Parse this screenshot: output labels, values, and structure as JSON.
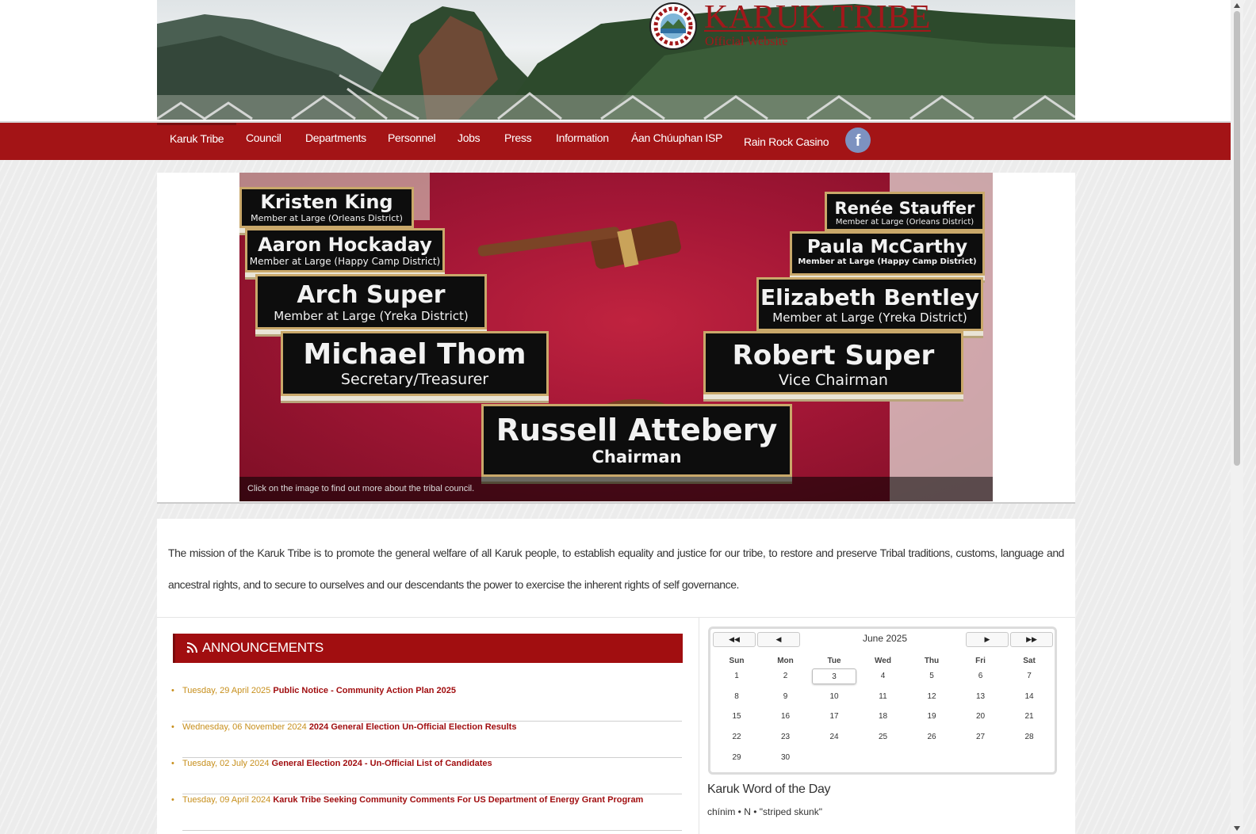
{
  "header": {
    "title": "KARUK TRIBE",
    "subtitle": "Official Website"
  },
  "nav": {
    "items": [
      {
        "label": "Karuk Tribe"
      },
      {
        "label": "Council"
      },
      {
        "label": "Departments"
      },
      {
        "label": "Personnel"
      },
      {
        "label": "Jobs"
      },
      {
        "label": "Press"
      },
      {
        "label": "Information"
      },
      {
        "label": "Áan Chúuphan ISP"
      },
      {
        "label": "Rain Rock Casino"
      }
    ],
    "facebook_icon": "facebook-icon",
    "facebook_glyph": "f"
  },
  "slideshow": {
    "caption": "Click on the image to find out more about the tribal council.",
    "plates": [
      {
        "name": "Kristen King",
        "role": "Member at Large (Orleans District)"
      },
      {
        "name": "Aaron Hockaday",
        "role": "Member at Large (Happy Camp District)"
      },
      {
        "name": "Arch Super",
        "role": "Member at Large (Yreka District)"
      },
      {
        "name": "Michael Thom",
        "role": "Secretary/Treasurer"
      },
      {
        "name": "Renée Stauffer",
        "role": "Member at Large (Orleans District)"
      },
      {
        "name": "Paula McCarthy",
        "role": "Member at Large (Happy Camp District)"
      },
      {
        "name": "Elizabeth Bentley",
        "role": "Member at Large (Yreka District)"
      },
      {
        "name": "Robert Super",
        "role": "Vice Chairman"
      },
      {
        "name": "Russell Attebery",
        "role": "Chairman"
      }
    ]
  },
  "mission": {
    "text": "The mission of the Karuk Tribe is to promote the general welfare of all Karuk people, to establish equality and justice for our tribe, to restore and preserve Tribal traditions, customs, language and ancestral rights, and to secure to ourselves and our descendants the power to exercise the inherent rights of self governance."
  },
  "announcements": {
    "title": "ANNOUNCEMENTS",
    "icon": "rss-icon",
    "items": [
      {
        "date": "Tuesday, 29 April 2025",
        "title": "Public Notice - Community Action Plan 2025"
      },
      {
        "date": "Wednesday, 06 November 2024",
        "title": "2024 General Election Un-Official Election Results"
      },
      {
        "date": "Tuesday, 02 July 2024",
        "title": "General Election 2024 - Un-Official List of Candidates"
      },
      {
        "date": "Tuesday, 09 April 2024",
        "title": "Karuk Tribe Seeking Community Comments For US Department of Energy Grant Program"
      }
    ]
  },
  "calendar": {
    "month_label": "June 2025",
    "buttons": {
      "prev_year": "◀◀",
      "prev_month": "◀",
      "next_month": "▶",
      "next_year": "▶▶"
    },
    "weekdays": [
      "Sun",
      "Mon",
      "Tue",
      "Wed",
      "Thu",
      "Fri",
      "Sat"
    ],
    "weeks": [
      [
        "1",
        "2",
        "3",
        "4",
        "5",
        "6",
        "7"
      ],
      [
        "8",
        "9",
        "10",
        "11",
        "12",
        "13",
        "14"
      ],
      [
        "15",
        "16",
        "17",
        "18",
        "19",
        "20",
        "21"
      ],
      [
        "22",
        "23",
        "24",
        "25",
        "26",
        "27",
        "28"
      ],
      [
        "29",
        "30",
        "",
        "",
        "",
        "",
        ""
      ]
    ],
    "today": "3"
  },
  "word_of_day": {
    "title": "Karuk Word of the Day",
    "text": "chínim • N • \"striped skunk\""
  },
  "colors": {
    "brand_red": "#a31416",
    "announcement_date": "#c78f1c",
    "announcement_link": "#a10e10",
    "facebook_blue": "#7d92c0"
  }
}
